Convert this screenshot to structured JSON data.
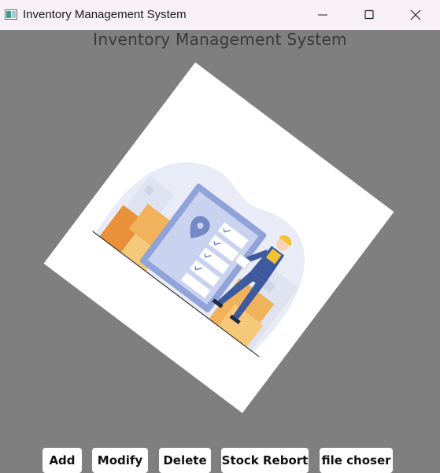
{
  "window": {
    "title": "Inventory Management System",
    "icon": "app-window-icon",
    "controls": [
      "minimize-icon",
      "maximize-icon",
      "close-icon"
    ]
  },
  "heading": "Inventory Management System",
  "illustration": {
    "subject": "warehouse-worker-checklist-illustration",
    "colors": {
      "boxes": "#f0b25a",
      "boxes_dark": "#e8913a",
      "board": "#8fa3d8",
      "worker_suit": "#3d5a9e",
      "helmet": "#f2c230",
      "blob": "#e9ebf6"
    }
  },
  "buttons": {
    "add": "Add",
    "modify": "Modify",
    "delete": "Delete",
    "stock": "Stock Rebort",
    "file": "file choser"
  },
  "colors": {
    "background": "#7f7f7f",
    "titlebar": "#f7f0f7"
  }
}
